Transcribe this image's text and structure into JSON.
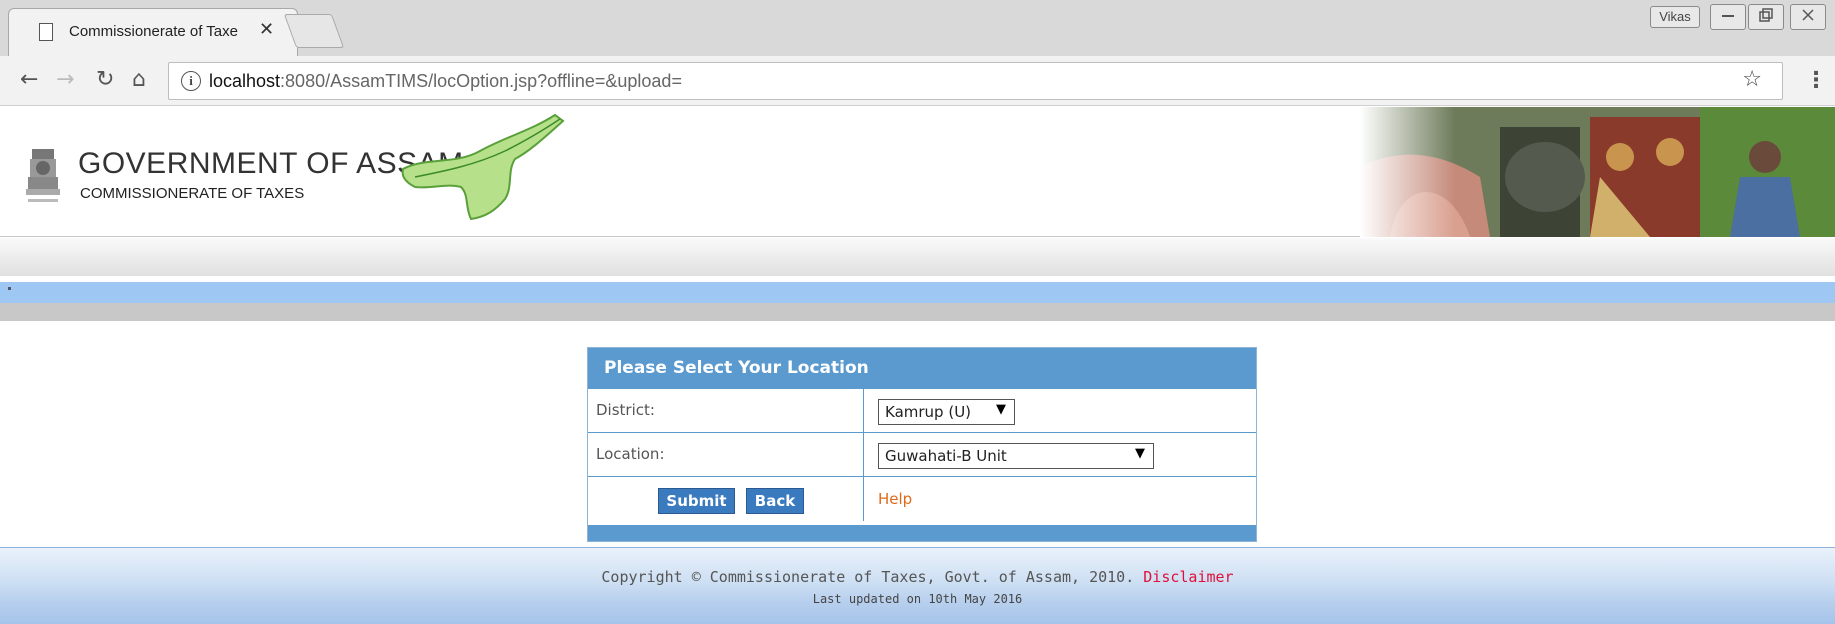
{
  "browser": {
    "tab_title": "Commissionerate of Taxe",
    "tab_close": "✕",
    "user_badge": "Vikas",
    "url_host": "localhost",
    "url_rest": ":8080/AssamTIMS/locOption.jsp?offline=&upload=",
    "icons": [
      "back-icon",
      "forward-icon",
      "reload-icon",
      "home-icon",
      "info-icon",
      "star-icon",
      "menu-icon"
    ]
  },
  "header": {
    "title": "GOVERNMENT OF ASSAM",
    "subtitle": "COMMISSIONERATE OF TAXES"
  },
  "panel": {
    "heading": "Please Select Your Location",
    "district_label": "District:",
    "district_value": "Kamrup (U)",
    "location_label": "Location:",
    "location_value": "Guwahati-B Unit",
    "submit_label": "Submit",
    "back_label": "Back",
    "help_label": "Help"
  },
  "footer": {
    "copyright": "Copyright © Commissionerate of Taxes, Govt. of Assam, 2010.",
    "disclaimer": "Disclaimer",
    "updated": "Last updated on 10th May 2016"
  },
  "colors": {
    "panel_header": "#5b9ace",
    "button": "#3a7abf",
    "help_link": "#e06a1a",
    "disclaimer_link": "#e0103a"
  }
}
